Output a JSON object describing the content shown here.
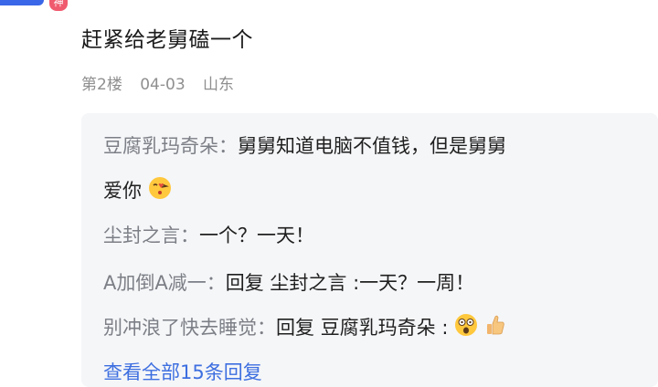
{
  "header": {
    "level_badge": "神"
  },
  "post": {
    "text": "赶紧给老舅磕一个",
    "floor": "第2楼",
    "date": "04-03",
    "location": "山东"
  },
  "sub_replies": [
    {
      "author": "豆腐乳玛奇朵",
      "sep": "：",
      "line1": "舅舅知道电脑不值钱，但是舅舅",
      "line2": "爱你",
      "emoji": "kiss-emoji"
    },
    {
      "author": "尘封之言",
      "sep": "：",
      "content": "一个？一天！"
    },
    {
      "author": "A加倒A减一",
      "sep": "：",
      "reply_label": "回复",
      "reply_to": "尘封之言",
      "content": ":一天？一周！"
    },
    {
      "author": "别冲浪了快去睡觉",
      "sep": "：",
      "reply_label": "回复",
      "reply_to": "豆腐乳玛奇朵",
      "content": ":",
      "emojis": [
        "shocked-emoji",
        "thumbs-up-emoji"
      ]
    }
  ],
  "view_all": "查看全部15条回复"
}
